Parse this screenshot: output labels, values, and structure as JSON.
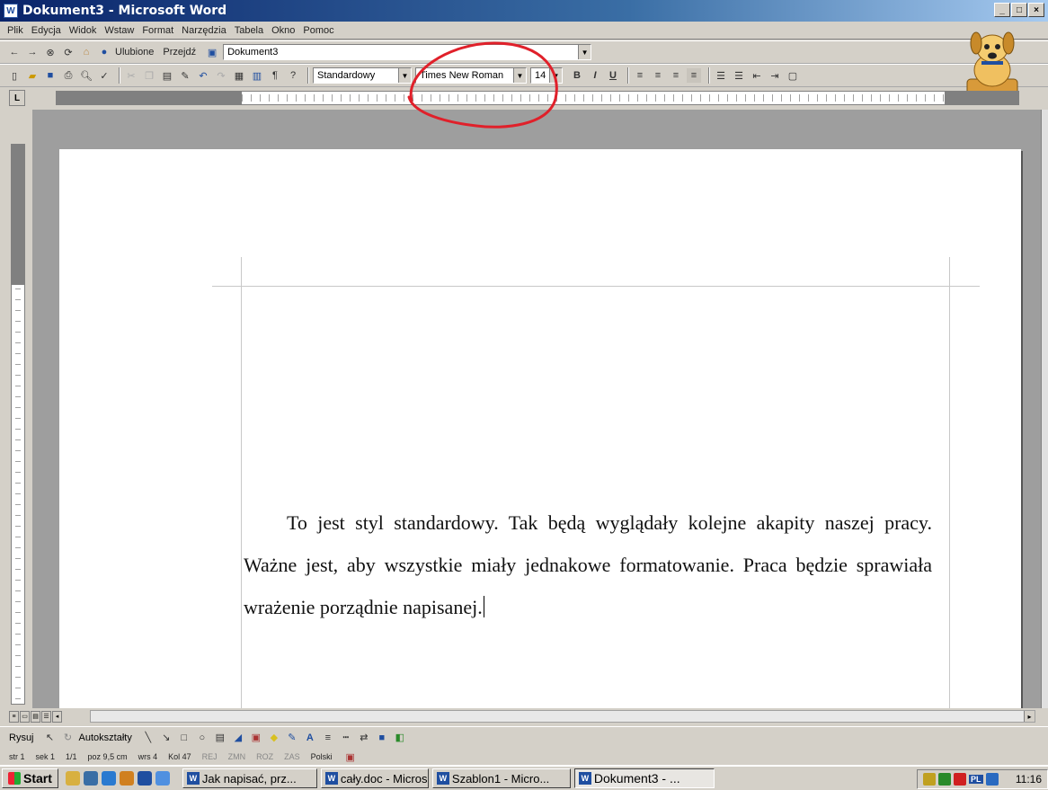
{
  "window": {
    "title": "Dokument3 - Microsoft Word",
    "app_icon": "word-icon",
    "controls": [
      "minimize-icon",
      "maximize-icon",
      "close-icon"
    ]
  },
  "menubar": {
    "items": [
      "Plik",
      "Edycja",
      "Widok",
      "Wstaw",
      "Format",
      "Narzędzia",
      "Tabela",
      "Okno",
      "Pomoc"
    ]
  },
  "web_toolbar": {
    "favorites_label": "Ulubione",
    "goto_label": "Przejdź",
    "address_value": "Dokument3"
  },
  "formatting_toolbar": {
    "style_value": "Standardowy",
    "font_value": "Times New Roman",
    "size_value": "14",
    "bold": "B",
    "italic": "I",
    "underline": "U"
  },
  "document": {
    "paragraph": "To jest styl standardowy. Tak będą wyglądały kolejne akapity naszej pracy. Ważne jest, aby wszystkie miały jednakowe formatowanie. Praca będzie sprawiała wrażenie porządnie napisanej."
  },
  "drawing_toolbar": {
    "draw_label": "Rysuj",
    "autoshapes_label": "Autokształty"
  },
  "statusbar": {
    "page": "str 1",
    "section": "sek 1",
    "pages": "1/1",
    "position": "poz 9,5 cm",
    "line": "wrs 4",
    "column": "Kol 47",
    "modes": [
      "REJ",
      "ZMN",
      "ROZ",
      "ZAS"
    ],
    "language": "Polski"
  },
  "taskbar": {
    "start_label": "Start",
    "tasks": [
      "Jak napisać, prz...",
      "cały.doc - Micros...",
      "Szablon1 - Micro...",
      "Dokument3 - ..."
    ],
    "tray_lang": "PL",
    "clock": "11:16"
  },
  "colors": {
    "title_bar": "#0a246a",
    "annotation": "#e0202a",
    "chrome": "#d4d0c8",
    "workspace": "#9e9e9e"
  }
}
